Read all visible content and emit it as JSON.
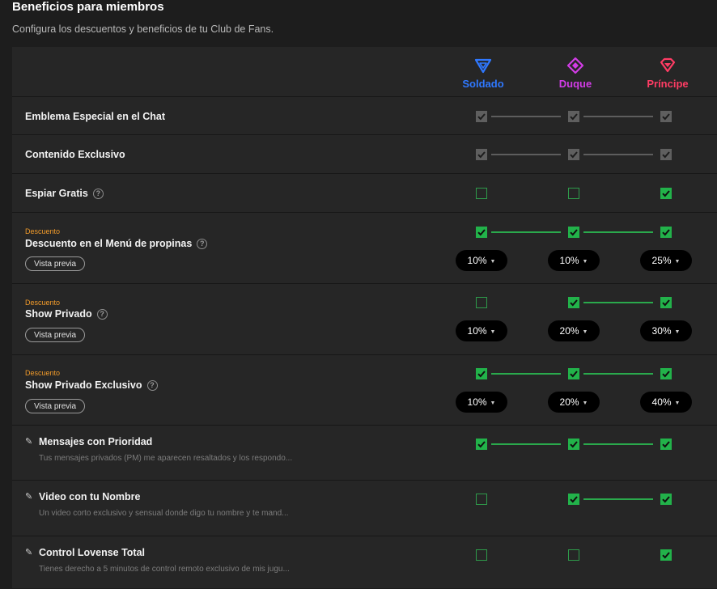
{
  "header": {
    "title": "Beneficios para miembros",
    "subtitle": "Configura los descuentos y beneficios de tu Club de Fans."
  },
  "tiers": [
    {
      "name": "Soldado",
      "color": "#2f78ff",
      "icon": "triangle-gem-icon"
    },
    {
      "name": "Duque",
      "color": "#d23ce6",
      "icon": "diamond-gem-icon"
    },
    {
      "name": "Príncipe",
      "color": "#ff3c64",
      "icon": "heart-gem-icon"
    }
  ],
  "common": {
    "discount_tag": "Descuento",
    "preview_label": "Vista previa",
    "help_glyph": "?"
  },
  "rows": [
    {
      "label": "Emblema Especial en el Chat",
      "checks": [
        "gray",
        "gray",
        "gray"
      ]
    },
    {
      "label": "Contenido Exclusivo",
      "checks": [
        "gray",
        "gray",
        "gray"
      ]
    },
    {
      "label": "Espiar Gratis",
      "checks": [
        "empty",
        "empty",
        "checked"
      ]
    },
    {
      "label": "Descuento en el Menú de propinas",
      "checks": [
        "checked",
        "checked",
        "checked"
      ],
      "discounts": [
        "10%",
        "10%",
        "25%"
      ]
    },
    {
      "label": "Show Privado",
      "checks": [
        "empty",
        "checked",
        "checked"
      ],
      "discounts": [
        "10%",
        "20%",
        "30%"
      ]
    },
    {
      "label": "Show Privado Exclusivo",
      "checks": [
        "checked",
        "checked",
        "checked"
      ],
      "discounts": [
        "10%",
        "20%",
        "40%"
      ]
    },
    {
      "label": "Mensajes con Prioridad",
      "description": "Tus mensajes privados (PM) me aparecen resaltados y los respondo...",
      "checks": [
        "checked",
        "checked",
        "checked"
      ]
    },
    {
      "label": "Video con tu Nombre",
      "description": "Un video corto exclusivo y sensual donde digo tu nombre y te mand...",
      "checks": [
        "empty",
        "checked",
        "checked"
      ]
    },
    {
      "label": "Control Lovense Total",
      "description": "Tienes derecho a 5 minutos de control remoto exclusivo de mis jugu...",
      "checks": [
        "empty",
        "empty",
        "checked"
      ]
    }
  ]
}
